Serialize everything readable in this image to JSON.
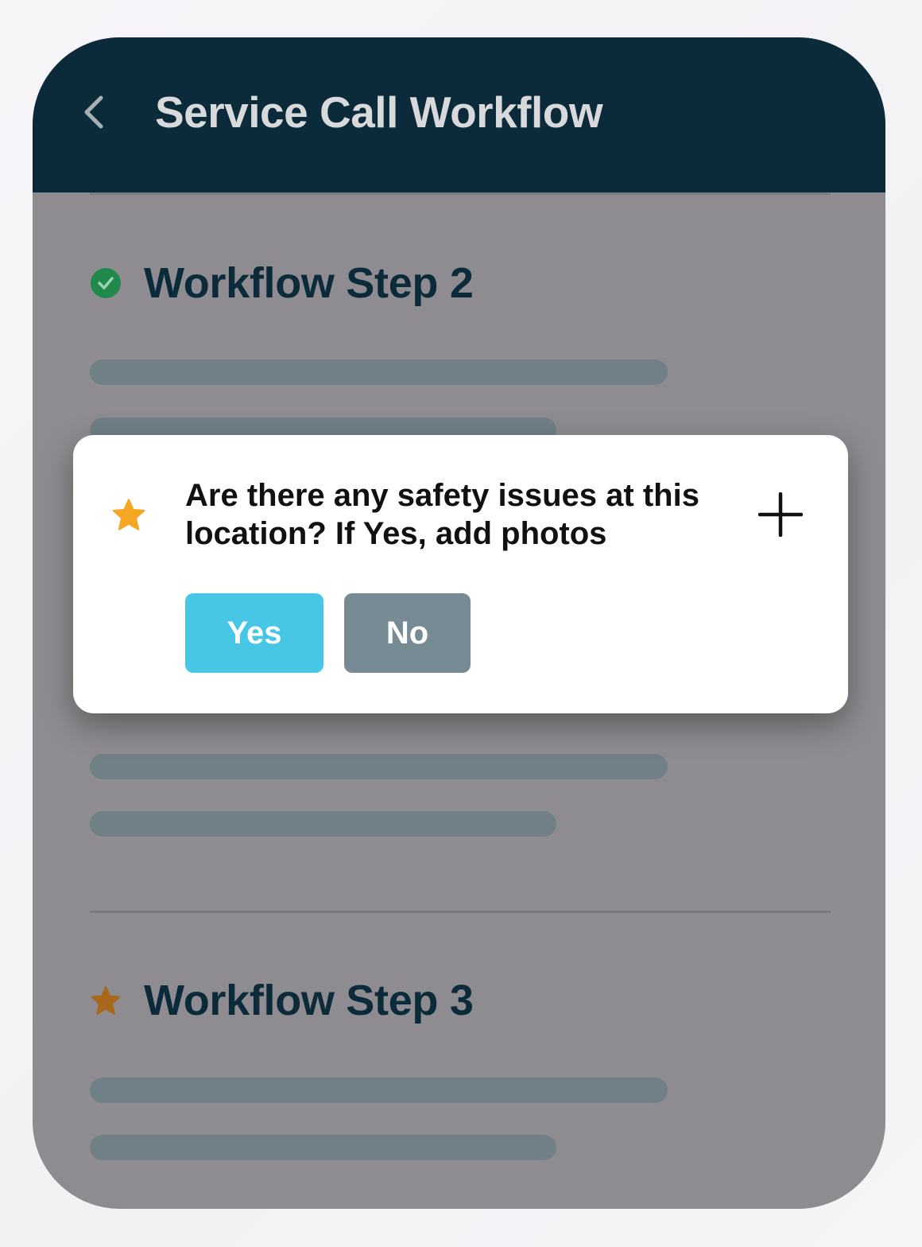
{
  "header": {
    "title": "Service Call Workflow",
    "back_icon": "chevron-left-icon",
    "background_color": "#0c2b3a"
  },
  "steps": [
    {
      "label": "Workflow Step 2",
      "status": "completed",
      "status_icon": "check-circle-icon",
      "status_color": "#1f8a4c"
    },
    {
      "label": "Workflow Step 3",
      "status": "required",
      "status_icon": "star-icon",
      "status_color": "#a8681b"
    }
  ],
  "modal": {
    "required_icon": "star-icon",
    "required_color": "#f5a623",
    "question": "Are there any safety issues at this location? If Yes, add photos",
    "add_icon": "plus-icon",
    "buttons": {
      "yes_label": "Yes",
      "no_label": "No",
      "yes_color": "#47c6e6",
      "no_color": "#778b95"
    }
  }
}
